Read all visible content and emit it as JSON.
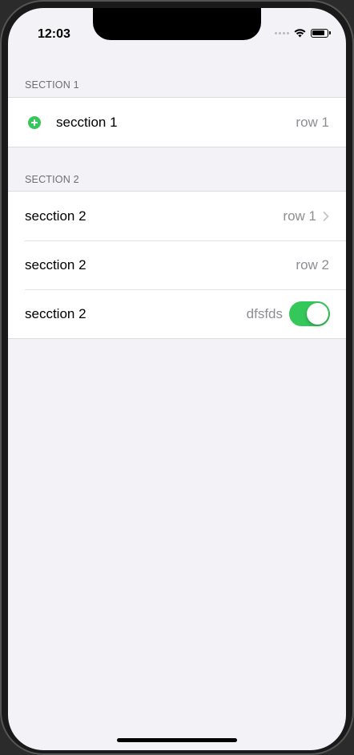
{
  "status_bar": {
    "time": "12:03",
    "icons": [
      "signal-icon",
      "wifi-icon",
      "battery-icon"
    ]
  },
  "sections": [
    {
      "header": "SECTION 1",
      "rows": [
        {
          "title": "secction 1",
          "detail": "row 1",
          "leading_icon": "add-icon"
        }
      ]
    },
    {
      "header": "SECTION 2",
      "rows": [
        {
          "title": "secction 2",
          "detail": "row 1",
          "accessory": "chevron-right-icon"
        },
        {
          "title": "secction 2",
          "detail": "row 2"
        },
        {
          "title": "secction 2",
          "detail": "dfsfds",
          "accessory": "toggle",
          "toggle_on": true
        }
      ]
    }
  ],
  "colors": {
    "accent_green": "#34c759",
    "background": "#f2f2f7",
    "secondary_text": "#8e8e93",
    "section_header_text": "#6d6d72"
  }
}
